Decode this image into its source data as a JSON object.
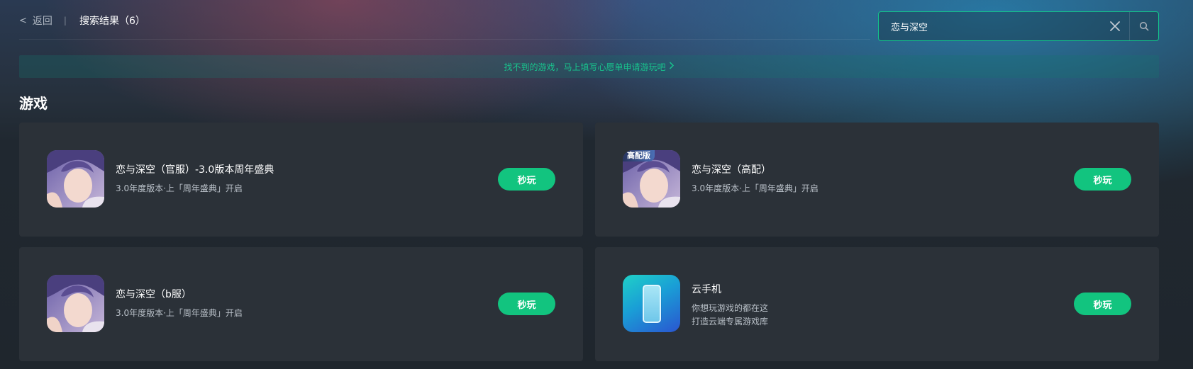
{
  "header": {
    "back_label": "返回",
    "separator": "|",
    "results_label": "搜索结果（6）"
  },
  "search": {
    "value": "恋与深空",
    "placeholder": ""
  },
  "banner": {
    "text": "找不到的游戏，马上填写心愿单申请游玩吧"
  },
  "section": {
    "title": "游戏"
  },
  "cards": [
    {
      "title": "恋与深空（官服）-3.0版本周年盛典",
      "desc": [
        "3.0年度版本·上「周年盛典」开启"
      ],
      "button": "秒玩",
      "icon": "character-avatar-icon"
    },
    {
      "title": "恋与深空（高配）",
      "desc": [
        "3.0年度版本·上「周年盛典」开启"
      ],
      "button": "秒玩",
      "icon": "character-avatar-icon",
      "badge": "高配版"
    },
    {
      "title": "恋与深空（b服）",
      "desc": [
        "3.0年度版本·上「周年盛典」开启"
      ],
      "button": "秒玩",
      "icon": "character-avatar-icon"
    },
    {
      "title": "云手机",
      "desc": [
        "你想玩游戏的都在这",
        "打造云端专属游戏库"
      ],
      "button": "秒玩",
      "icon": "cloud-phone-icon"
    }
  ],
  "colors": {
    "accent": "#12c47f",
    "card_bg": "#2b3138",
    "banner_text": "#18c48d"
  }
}
